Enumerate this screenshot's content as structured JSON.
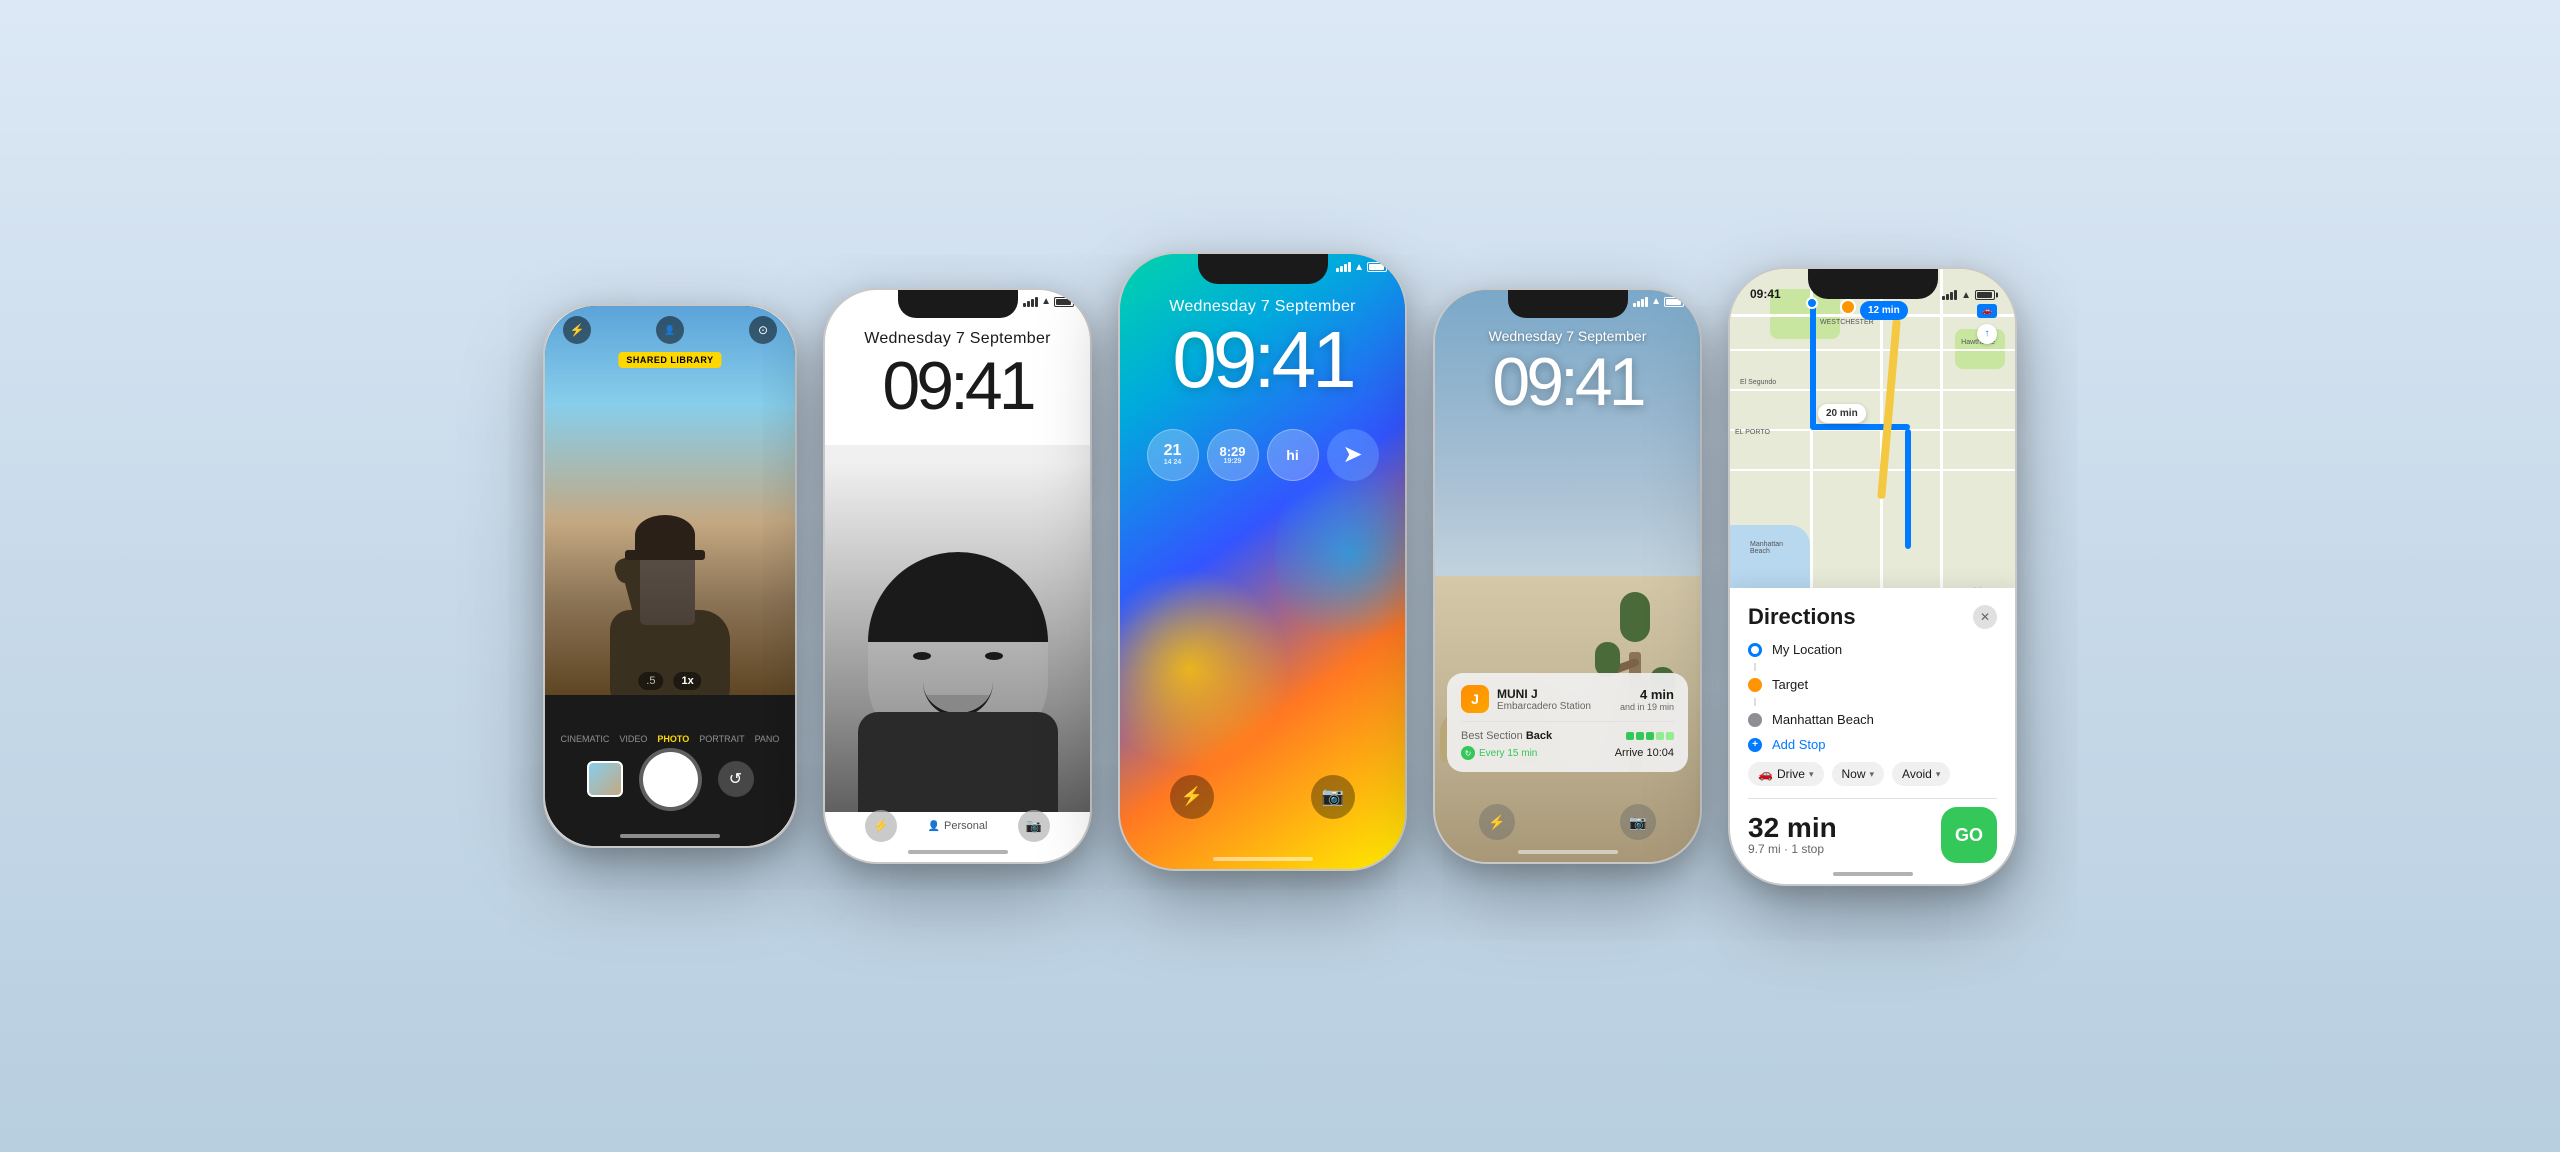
{
  "background": {
    "color": "#d0e0ee"
  },
  "phones": [
    {
      "id": "phone1",
      "type": "camera",
      "badge": "SHARED LIBRARY",
      "modes": [
        "CINEMATIC",
        "VIDEO",
        "PHOTO",
        "PORTRAIT",
        "PANO"
      ],
      "active_mode": "PHOTO",
      "zoom_levels": [
        ".5",
        "1x"
      ]
    },
    {
      "id": "phone2",
      "type": "lock_screen_bw",
      "date": "Wednesday 7 September",
      "time": "09:41",
      "profile_label": "Personal",
      "status": {
        "signal": true,
        "wifi": true,
        "battery": true
      }
    },
    {
      "id": "phone3",
      "type": "lock_screen_color",
      "date": "Wednesday 7 September",
      "time": "09:41",
      "widgets": [
        {
          "main": "21",
          "sub1": "14",
          "sub2": "24",
          "label": ""
        },
        {
          "main": "8:29",
          "sub1": "",
          "sub2": "",
          "label": ""
        },
        {
          "main": "hi",
          "sub1": "",
          "sub2": "",
          "label": ""
        }
      ]
    },
    {
      "id": "phone4",
      "type": "lock_screen_nature",
      "date": "Wednesday 7 September",
      "time": "09:41",
      "notification": {
        "title": "MUNI J",
        "subtitle": "Embarcadero Station",
        "time": "4 min",
        "time2": "and in 19 min",
        "section_label": "Best Section",
        "section_value": "Back",
        "frequency": "Every 15 min",
        "arrive": "Arrive 10:04"
      },
      "status": {
        "signal": true,
        "wifi": true,
        "battery": true
      }
    },
    {
      "id": "phone5",
      "type": "maps",
      "status_time": "09:41",
      "map": {
        "time_bubbles": [
          "12 min",
          "20 min"
        ],
        "locations": [
          "My Location",
          "Target",
          "Manhattan Beach"
        ]
      },
      "directions": {
        "title": "Directions",
        "stops": [
          {
            "label": "My Location",
            "icon": "blue-dot"
          },
          {
            "label": "Target",
            "icon": "orange-pin"
          },
          {
            "label": "Manhattan Beach",
            "icon": "gray-dot"
          },
          {
            "label": "Add Stop",
            "icon": "plus-blue"
          }
        ],
        "options": [
          {
            "icon": "car",
            "label": "Drive",
            "chevron": true
          },
          {
            "icon": "clock",
            "label": "Now",
            "chevron": true
          },
          {
            "icon": "shield",
            "label": "Avoid",
            "chevron": true
          }
        ],
        "time": "32 min",
        "distance": "9.7 mi · 1 stop",
        "go_label": "GO"
      }
    }
  ]
}
